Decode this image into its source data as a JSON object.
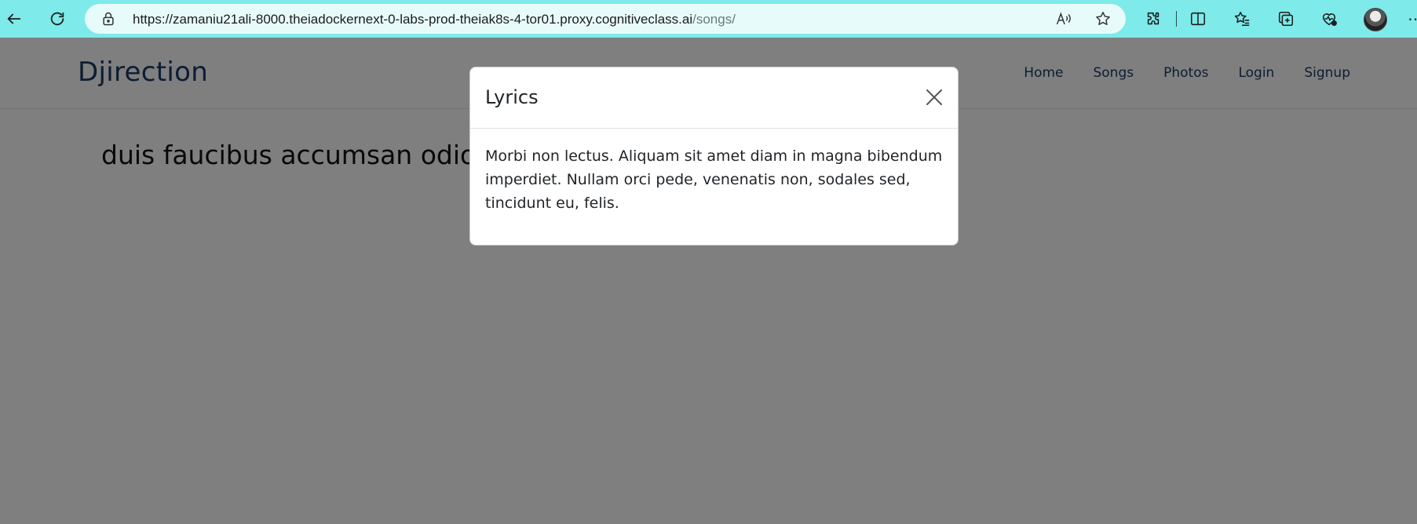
{
  "browser": {
    "url_host": "https://zamaniu21ali-8000.theiadockernext-0-labs-prod-theiak8s-4-tor01.proxy.cognitiveclass.ai",
    "url_path": "/songs/",
    "icons": [
      "back-icon",
      "refresh-icon",
      "lock-icon",
      "read-aloud-icon",
      "favorite-star-icon",
      "extensions-icon",
      "split-screen-icon",
      "favorites-icon",
      "collections-icon",
      "browser-essentials-icon",
      "profile-avatar",
      "more-icon"
    ],
    "toolbar_color": "#7eeaea"
  },
  "navbar": {
    "brand": "Djirection",
    "links": [
      "Home",
      "Songs",
      "Photos",
      "Login",
      "Signup"
    ]
  },
  "main": {
    "song_title": "duis faucibus accumsan odio"
  },
  "modal": {
    "title": "Lyrics",
    "body": "Morbi non lectus. Aliquam sit amet diam in magna bibendum imperdiet. Nullam orci pede, venenatis non, sodales sed, tincidunt eu, felis.",
    "close_label": "Close"
  },
  "colors": {
    "brand": "#1b3a66",
    "backdrop": "rgba(0,0,0,0.5)"
  }
}
